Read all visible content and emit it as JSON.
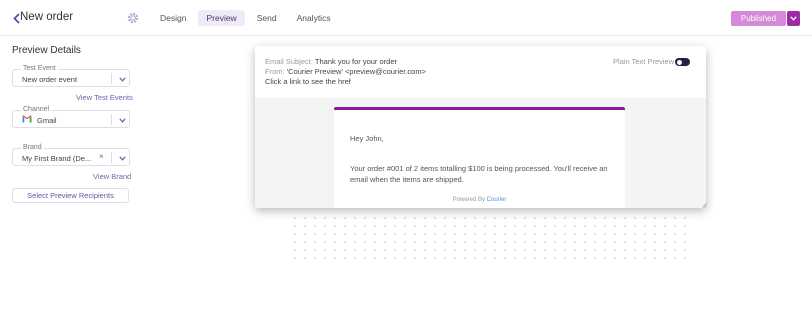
{
  "header": {
    "title": "New order",
    "tabs": [
      {
        "label": "Design",
        "active": false
      },
      {
        "label": "Preview",
        "active": true
      },
      {
        "label": "Send",
        "active": false
      },
      {
        "label": "Analytics",
        "active": false
      }
    ],
    "publish_label": "Published",
    "icons": {
      "back": "chevron-left-icon",
      "settings": "gear-icon",
      "dropdown": "chevron-down-icon"
    }
  },
  "panel": {
    "title": "Preview Details",
    "test_event": {
      "legend": "Test Event",
      "value": "New order event",
      "link": "View Test Events"
    },
    "channel": {
      "legend": "Channel",
      "value": "Gmail",
      "icon": "gmail-icon"
    },
    "brand": {
      "legend": "Brand",
      "value": "My First Brand (De...",
      "link": "View Brand"
    },
    "recipients_button": "Select Preview Recipients"
  },
  "preview": {
    "subject_label": "Email Subject:",
    "subject_value": "Thank you for your order",
    "from_label": "From:",
    "from_value": "'Courier Preview' <preview@courier.com>",
    "hint": "Click a link to see the href",
    "plain_text_label": "Plain Text Preview",
    "plain_text_enabled": true,
    "email": {
      "greeting": "Hey John,",
      "body": "Your order #001 of 2 items totalling $100 is being processed. You'll receive an email when the items are shipped.",
      "powered_by": "Powered By",
      "powered_brand": "Courier"
    }
  },
  "colors": {
    "accent": "#8a1b93",
    "publish": "#d48ad9",
    "publish_dropdown": "#9d2aa6",
    "link": "#7a5cb0",
    "toggle": "#232040"
  }
}
